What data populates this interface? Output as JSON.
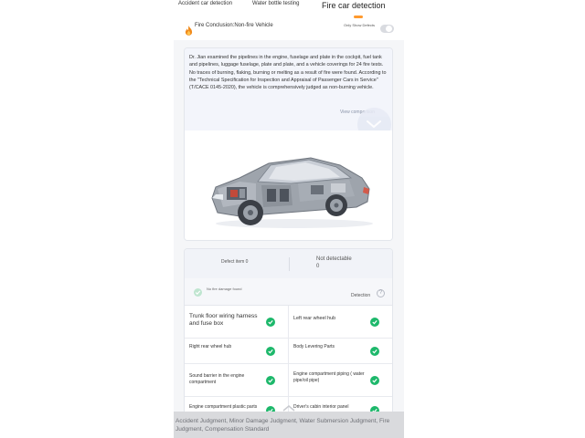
{
  "tabs": [
    {
      "label": "Accident car detection"
    },
    {
      "label": "Water bottle testing"
    },
    {
      "label": "Fire car detection"
    }
  ],
  "conclusion": {
    "text": "Fire Conclusion:Non-fire Vehicle",
    "toggle_label": "Only Show Defects",
    "toggle_on": false,
    "icon": "fire-icon"
  },
  "description": {
    "text": "Dr. Jian examined the pipelines in the engine, fuselage and plate in the cockpit, fuel tank and pipelines, luggage fuselage, plate and plate, and a vehicle coverings for 24 fire tests. No traces of burning, flaking, burning or melting as a result of fire were found. According to the \"Technical Specification for Inspection and Appraisal of Passenger Cars in Service\" (T/CACE 0145-2020), the vehicle is comprehensively judged as non-burning vehicle.",
    "view_comparison": "View comparison"
  },
  "stats": {
    "defect_label": "Defect item 0",
    "not_detectable_label": "Not detectable",
    "not_detectable_value": "0",
    "no_damage_label": "No fire damage found",
    "detection_label": "Detection"
  },
  "items": [
    {
      "label": "Trunk floor wiring harness and fuse box",
      "status": "ok"
    },
    {
      "label": "Left rear wheel hub",
      "status": "ok"
    },
    {
      "label": "Right rear wheel hub",
      "status": "ok"
    },
    {
      "label": "Body Levering Parts",
      "status": "ok"
    },
    {
      "label": "Sound barrier in the engine compartment",
      "status": "ok"
    },
    {
      "label": "Engine compartment piping ( water pipe/oil pipe)",
      "status": "ok"
    },
    {
      "label": "Engine compartment plastic parts",
      "status": "ok"
    },
    {
      "label": "Driver's cabin interior panel",
      "status": "ok"
    }
  ],
  "footer": {
    "text": "Accident Judgment, Minor Damage Judgment, Water Submersion Judgment, Fire Judgment, Compensation Standard"
  },
  "colors": {
    "accent": "#ff9a2e",
    "check": "#1db86b",
    "fire": "#f08a1c"
  }
}
